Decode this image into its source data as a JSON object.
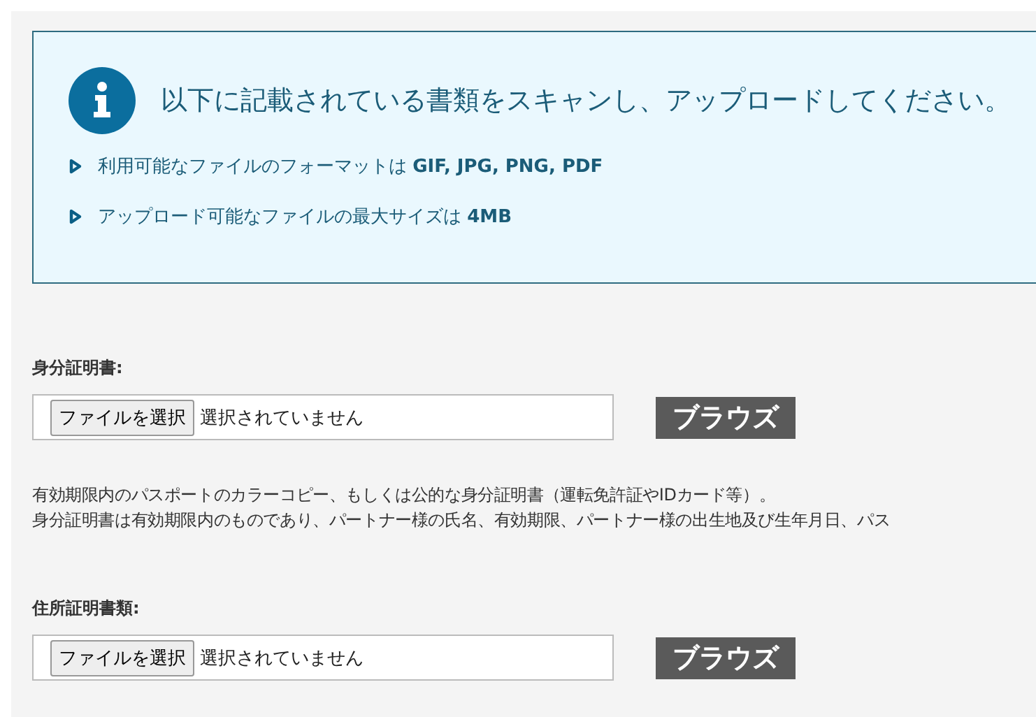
{
  "notice": {
    "title": "以下に記載されている書類をスキャンし、アップロードしてください。",
    "bullets": [
      "利用可能なファイルのフォーマットは **GIF, JPG, PNG, PDF**",
      "アップロード可能なファイルの最大サイズは **4MB**"
    ]
  },
  "fields": [
    {
      "label": "身分証明書:",
      "choose_button": "ファイルを選択",
      "file_status": "選択されていません",
      "browse_button": "ブラウズ",
      "notes": [
        "有効期限内のパスポートのカラーコピー、もしくは公的な身分証明書（運転免許証やIDカード等）。",
        "身分証明書は有効期限内のものであり、パートナー様の氏名、有効期限、パートナー様の出生地及び生年月日、パス"
      ]
    },
    {
      "label": "住所証明書類:",
      "choose_button": "ファイルを選択",
      "file_status": "選択されていません",
      "browse_button": "ブラウズ"
    }
  ]
}
